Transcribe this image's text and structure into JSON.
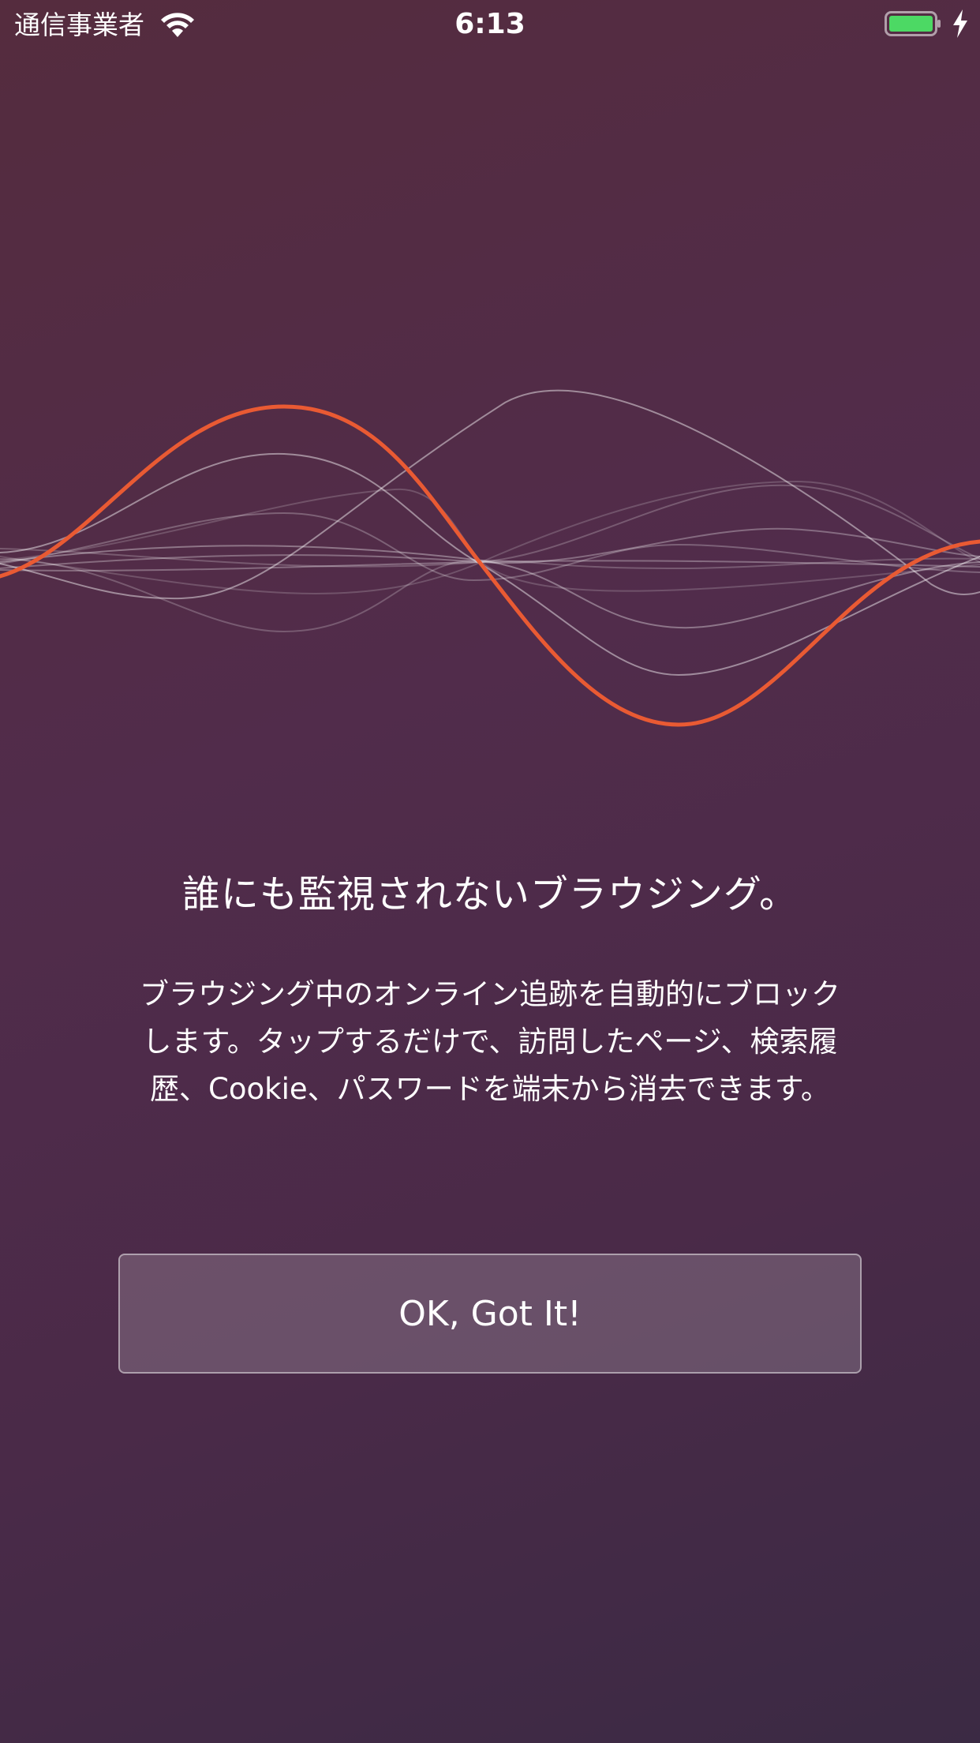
{
  "status_bar": {
    "carrier": "通信事業者",
    "time": "6:13",
    "battery_color": "#4cd964"
  },
  "icons": {
    "wifi": "wifi-icon",
    "battery": "battery-icon",
    "charging": "charging-bolt-icon"
  },
  "main": {
    "headline": "誰にも監視されないブラウジング。",
    "description_lines": [
      "ブラウジング中のオンライン追跡を自動的にブロック",
      "します。タップするだけで、訪問したページ、検索履",
      "歴、Cookie、パスワードを端末から消去できます。"
    ],
    "button_label": "OK, Got It!"
  },
  "colors": {
    "accent_wave": "#e95a33",
    "background_top": "#552c3e",
    "background_bottom": "#3b2a44"
  }
}
